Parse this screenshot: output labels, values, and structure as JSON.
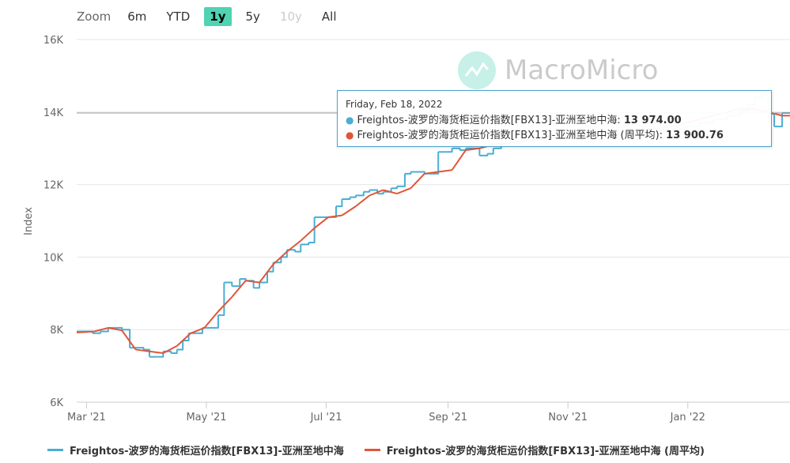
{
  "zoom": {
    "label": "Zoom",
    "buttons": [
      "6m",
      "YTD",
      "1y",
      "5y",
      "10y",
      "All"
    ],
    "active": "1y",
    "disabled": [
      "10y"
    ]
  },
  "watermark": {
    "text": "MacroMicro"
  },
  "colors": {
    "series1": "#4aaed4",
    "series2": "#e0553a",
    "zoom_active": "#4fd3b2",
    "tooltip_border": "#4aa4cf"
  },
  "tooltip": {
    "date": "Friday, Feb 18, 2022",
    "rows": [
      {
        "label": "Freightos-波罗的海货柜运价指数[FBX13]-亚洲至地中海: ",
        "value": "13 974.00"
      },
      {
        "label": "Freightos-波罗的海货柜运价指数[FBX13]-亚洲至地中海 (周平均): ",
        "value": "13 900.76"
      }
    ]
  },
  "legend": [
    "Freightos-波罗的海货柜运价指数[FBX13]-亚洲至地中海",
    "Freightos-波罗的海货柜运价指数[FBX13]-亚洲至地中海 (周平均)"
  ],
  "chart_data": {
    "type": "line",
    "ylabel": "Index",
    "ylim": [
      6000,
      16000
    ],
    "yticks": [
      6000,
      8000,
      10000,
      12000,
      14000,
      16000
    ],
    "ytick_labels": [
      "6K",
      "8K",
      "10K",
      "12K",
      "14K",
      "16K"
    ],
    "xlim": [
      "2021-02-24",
      "2022-02-22"
    ],
    "xticks": [
      "2021-03-01",
      "2021-05-01",
      "2021-07-01",
      "2021-09-01",
      "2021-11-01",
      "2022-01-01"
    ],
    "xtick_labels": [
      "Mar '21",
      "May '21",
      "Jul '21",
      "Sep '21",
      "Nov '21",
      "Jan '22"
    ],
    "grid": true,
    "legend_position": "bottom",
    "series": [
      {
        "name": "Freightos-波罗的海货柜运价指数[FBX13]-亚洲至地中海",
        "x": [
          "2021-02-24",
          "2021-03-01",
          "2021-03-04",
          "2021-03-08",
          "2021-03-12",
          "2021-03-16",
          "2021-03-19",
          "2021-03-23",
          "2021-03-26",
          "2021-03-30",
          "2021-04-02",
          "2021-04-06",
          "2021-04-09",
          "2021-04-13",
          "2021-04-16",
          "2021-04-19",
          "2021-04-22",
          "2021-04-26",
          "2021-04-29",
          "2021-05-03",
          "2021-05-06",
          "2021-05-07",
          "2021-05-10",
          "2021-05-14",
          "2021-05-18",
          "2021-05-21",
          "2021-05-25",
          "2021-05-28",
          "2021-06-01",
          "2021-06-04",
          "2021-06-08",
          "2021-06-11",
          "2021-06-15",
          "2021-06-18",
          "2021-06-22",
          "2021-06-25",
          "2021-06-29",
          "2021-07-02",
          "2021-07-06",
          "2021-07-09",
          "2021-07-13",
          "2021-07-16",
          "2021-07-20",
          "2021-07-23",
          "2021-07-27",
          "2021-07-30",
          "2021-08-03",
          "2021-08-06",
          "2021-08-10",
          "2021-08-13",
          "2021-08-17",
          "2021-08-20",
          "2021-08-24",
          "2021-08-27",
          "2021-08-31",
          "2021-09-03",
          "2021-09-07",
          "2021-09-10",
          "2021-09-14",
          "2021-09-17",
          "2021-09-21",
          "2021-09-24",
          "2021-09-28",
          "2021-10-01",
          "2021-10-08",
          "2021-10-15",
          "2021-10-22",
          "2021-10-29",
          "2021-11-05",
          "2021-11-12",
          "2021-11-19",
          "2021-11-26",
          "2021-12-03",
          "2021-12-10",
          "2021-12-17",
          "2021-12-24",
          "2021-12-31",
          "2022-01-07",
          "2022-01-14",
          "2022-01-21",
          "2022-01-28",
          "2022-02-01",
          "2022-02-04",
          "2022-02-08",
          "2022-02-11",
          "2022-02-14",
          "2022-02-18",
          "2022-02-22"
        ],
        "y": [
          7950,
          7950,
          7900,
          7950,
          8050,
          8050,
          8000,
          7500,
          7500,
          7450,
          7250,
          7250,
          7400,
          7350,
          7450,
          7700,
          7900,
          7900,
          8050,
          8050,
          8050,
          8400,
          9300,
          9200,
          9400,
          9350,
          9150,
          9300,
          9600,
          9850,
          10000,
          10200,
          10150,
          10350,
          10400,
          11100,
          11100,
          11100,
          11400,
          11600,
          11650,
          11700,
          11800,
          11850,
          11750,
          11800,
          11900,
          11950,
          12300,
          12350,
          12350,
          12300,
          12300,
          12900,
          12900,
          13000,
          12950,
          13000,
          13000,
          12800,
          12850,
          13000,
          13100,
          13150,
          13200,
          13250,
          13300,
          13350,
          13300,
          13250,
          13300,
          13350,
          13400,
          13450,
          13500,
          13550,
          13600,
          13700,
          13800,
          13900,
          14050,
          14200,
          14400,
          14500,
          13950,
          13600,
          13974,
          13990
        ]
      },
      {
        "name": "Freightos-波罗的海货柜运价指数[FBX13]-亚洲至地中海 (周平均)",
        "x": [
          "2021-02-24",
          "2021-03-05",
          "2021-03-12",
          "2021-03-19",
          "2021-03-26",
          "2021-04-02",
          "2021-04-09",
          "2021-04-16",
          "2021-04-23",
          "2021-04-30",
          "2021-05-07",
          "2021-05-14",
          "2021-05-21",
          "2021-05-28",
          "2021-06-04",
          "2021-06-11",
          "2021-06-18",
          "2021-06-25",
          "2021-07-02",
          "2021-07-09",
          "2021-07-16",
          "2021-07-23",
          "2021-07-30",
          "2021-08-06",
          "2021-08-13",
          "2021-08-20",
          "2021-08-27",
          "2021-09-03",
          "2021-09-10",
          "2021-09-17",
          "2021-09-24",
          "2021-10-01",
          "2021-10-08",
          "2021-10-15",
          "2021-10-22",
          "2021-10-29",
          "2021-11-05",
          "2021-11-12",
          "2021-11-19",
          "2021-11-26",
          "2021-12-03",
          "2021-12-10",
          "2021-12-17",
          "2021-12-24",
          "2021-12-31",
          "2022-01-07",
          "2022-01-14",
          "2022-01-21",
          "2022-01-28",
          "2022-02-04",
          "2022-02-11",
          "2022-02-18",
          "2022-02-22"
        ],
        "y": [
          7920,
          7950,
          8050,
          7980,
          7450,
          7400,
          7350,
          7550,
          7900,
          8050,
          8500,
          8900,
          9350,
          9300,
          9800,
          10150,
          10450,
          10800,
          11100,
          11150,
          11400,
          11700,
          11850,
          11750,
          11900,
          12300,
          12350,
          12400,
          12950,
          13000,
          13100,
          13150,
          13200,
          13250,
          13300,
          13300,
          13300,
          13300,
          13350,
          13400,
          13450,
          13500,
          13550,
          13600,
          13700,
          13800,
          13900,
          14000,
          14100,
          14080,
          14000,
          13900,
          13900
        ]
      }
    ]
  }
}
